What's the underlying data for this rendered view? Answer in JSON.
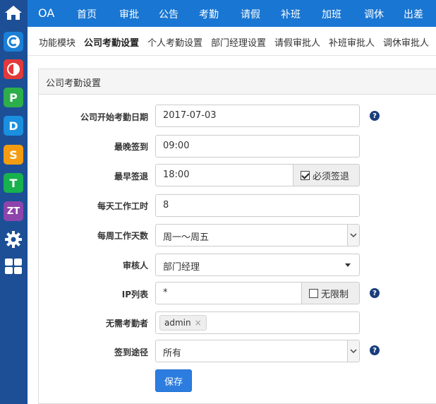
{
  "topnav": {
    "brand": "OA",
    "items": [
      "首页",
      "审批",
      "公告",
      "考勤",
      "请假",
      "补班",
      "加班",
      "调休",
      "出差"
    ]
  },
  "subnav": {
    "items": [
      "功能模块",
      "公司考勤设置",
      "个人考勤设置",
      "部门经理设置",
      "请假审批人",
      "补班审批人",
      "调休审批人"
    ],
    "active": "公司考勤设置"
  },
  "dock": {
    "icons": [
      "home-icon",
      "app-c-icon",
      "app-circle-icon",
      "app-p-icon",
      "app-d-icon",
      "app-s-icon",
      "app-t-icon",
      "app-zt-icon",
      "gear-icon",
      "grid-icon"
    ],
    "letters": {
      "c": "C",
      "p": "P",
      "d": "D",
      "s": "S",
      "t": "T",
      "zt": "ZT"
    }
  },
  "panel": {
    "title": "公司考勤设置",
    "fields": {
      "start_date": {
        "label": "公司开始考勤日期",
        "value": "2017-07-03"
      },
      "latest_checkin": {
        "label": "最晚签到",
        "value": "09:00"
      },
      "earliest_checkout": {
        "label": "最早签退",
        "value": "18:00",
        "addon": "必须签退",
        "checked": true
      },
      "daily_hours": {
        "label": "每天工作工时",
        "value": "8"
      },
      "weekly_days": {
        "label": "每周工作天数",
        "value": "周一～周五"
      },
      "approver": {
        "label": "审核人",
        "value": "部门经理"
      },
      "ip_list": {
        "label": "IP列表",
        "value": "*",
        "addon": "无限制",
        "checked": false
      },
      "exempt": {
        "label": "无需考勤者",
        "tag": "admin",
        "tag_remove": "×"
      },
      "signin_method": {
        "label": "签到途径",
        "value": "所有"
      }
    },
    "save_label": "保存",
    "help_glyph": "?"
  }
}
